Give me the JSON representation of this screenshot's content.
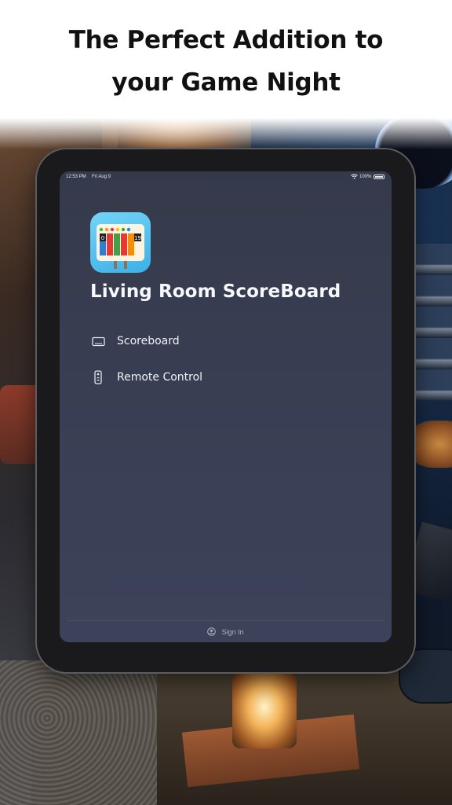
{
  "promo": {
    "headline_line1": "The Perfect Addition to",
    "headline_line2": "your Game Night"
  },
  "status_bar": {
    "time": "12:53 PM",
    "date": "Fri Aug 9",
    "battery": "100%"
  },
  "app": {
    "title": "Living Room ScoreBoard",
    "icon_scores": [
      "0",
      "19"
    ]
  },
  "sidebar": {
    "items": [
      {
        "label": "Scoreboard",
        "icon": "monitor-icon"
      },
      {
        "label": "Remote Control",
        "icon": "remote-icon"
      }
    ]
  },
  "footer": {
    "sign_in_label": "Sign In",
    "sign_in_icon": "person-circle-icon"
  },
  "colors": {
    "screen_background": "#3a3f55",
    "text_primary": "#f7f8fb",
    "text_muted": "#aeb3c2",
    "icon_background": "#3cb0e6"
  }
}
